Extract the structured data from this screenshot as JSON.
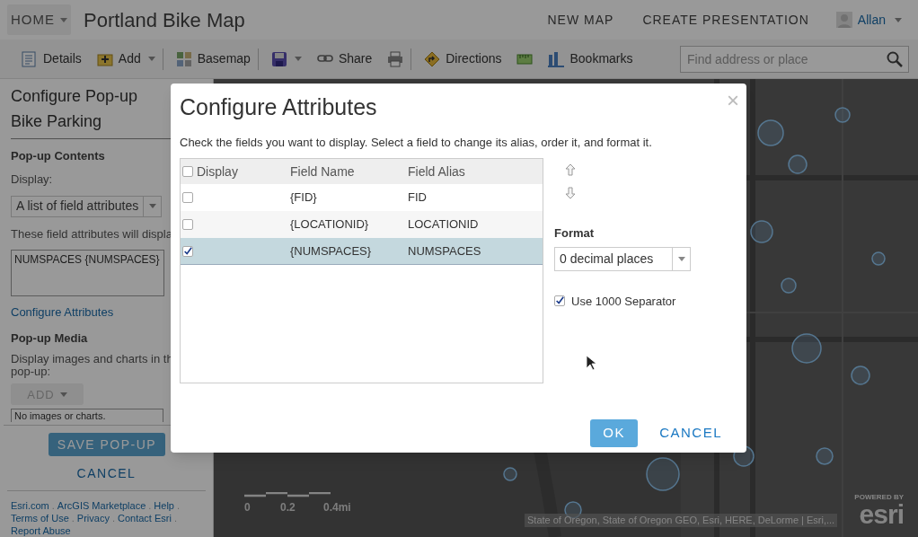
{
  "header": {
    "home": "HOME",
    "title": "Portland Bike Map",
    "links": [
      "NEW MAP",
      "CREATE PRESENTATION"
    ],
    "user": "Allan"
  },
  "toolbar": {
    "items": [
      {
        "label": "Details",
        "dropdown": false,
        "separator_after": false
      },
      {
        "label": "Add",
        "dropdown": true,
        "separator_after": true
      },
      {
        "label": "Basemap",
        "dropdown": false,
        "separator_after": true
      },
      {
        "dropdown": true,
        "separator_after": false
      },
      {
        "label": "Share",
        "dropdown": false,
        "separator_after": false
      },
      {
        "dropdown": false,
        "separator_after": true
      },
      {
        "label": "Directions",
        "dropdown": false,
        "separator_after": false
      },
      {
        "dropdown": false,
        "separator_after": false
      },
      {
        "label": "Bookmarks",
        "dropdown": false,
        "separator_after": false
      }
    ],
    "search_placeholder": "Find address or place"
  },
  "sidebar": {
    "heading": "Configure Pop-up",
    "layer": "Bike Parking",
    "contents_heading": "Pop-up Contents",
    "display_label": "Display:",
    "display_value": "A list of field attributes",
    "fields_note": "These field attributes will displa",
    "fields_text": "NUMSPACES {NUMSPACES}",
    "configure_link": "Configure Attributes",
    "media_heading": "Pop-up Media",
    "media_note_lines": [
      "Display images and charts in th",
      "pop-up:"
    ],
    "add_button": {
      "label": "ADD",
      "disabled": true
    },
    "media_list": "No images or charts.",
    "save_button": "SAVE POP-UP",
    "cancel_button": "CANCEL",
    "footer_separator": ".",
    "footer_links": [
      [
        "Esri.com",
        "ArcGIS Marketplace",
        "Help"
      ],
      [
        "Terms of Use",
        "Privacy",
        "Contact Esri"
      ],
      [
        "Report Abuse"
      ]
    ]
  },
  "map": {
    "scale_labels": [
      "0",
      "0.2",
      "0.4mi"
    ],
    "attribution": "State of Oregon, State of Oregon GEO, Esri, HERE, DeLorme | Esri,...",
    "logo": {
      "powered_by": "POWERED BY",
      "name": "esri"
    }
  },
  "dialog": {
    "title": "Configure Attributes",
    "close": "×",
    "instructions": "Check the fields you want to display. Select a field to change its alias, order it, and format it.",
    "columns": [
      "Display",
      "Field Name",
      "Field Alias"
    ],
    "select_all_checked": false,
    "rows": [
      {
        "name": "{FID}",
        "alias": "FID",
        "checked": false,
        "selected": false
      },
      {
        "name": "{LOCATIONID}",
        "alias": "LOCATIONID",
        "checked": false,
        "selected": false
      },
      {
        "name": "{NUMSPACES}",
        "alias": "NUMSPACES",
        "checked": true,
        "selected": true
      }
    ],
    "format_label": "Format",
    "format_value": "0 decimal places",
    "separator_option": {
      "label": "Use 1000 Separator",
      "checked": true
    },
    "ok": "OK",
    "cancel": "CANCEL"
  }
}
